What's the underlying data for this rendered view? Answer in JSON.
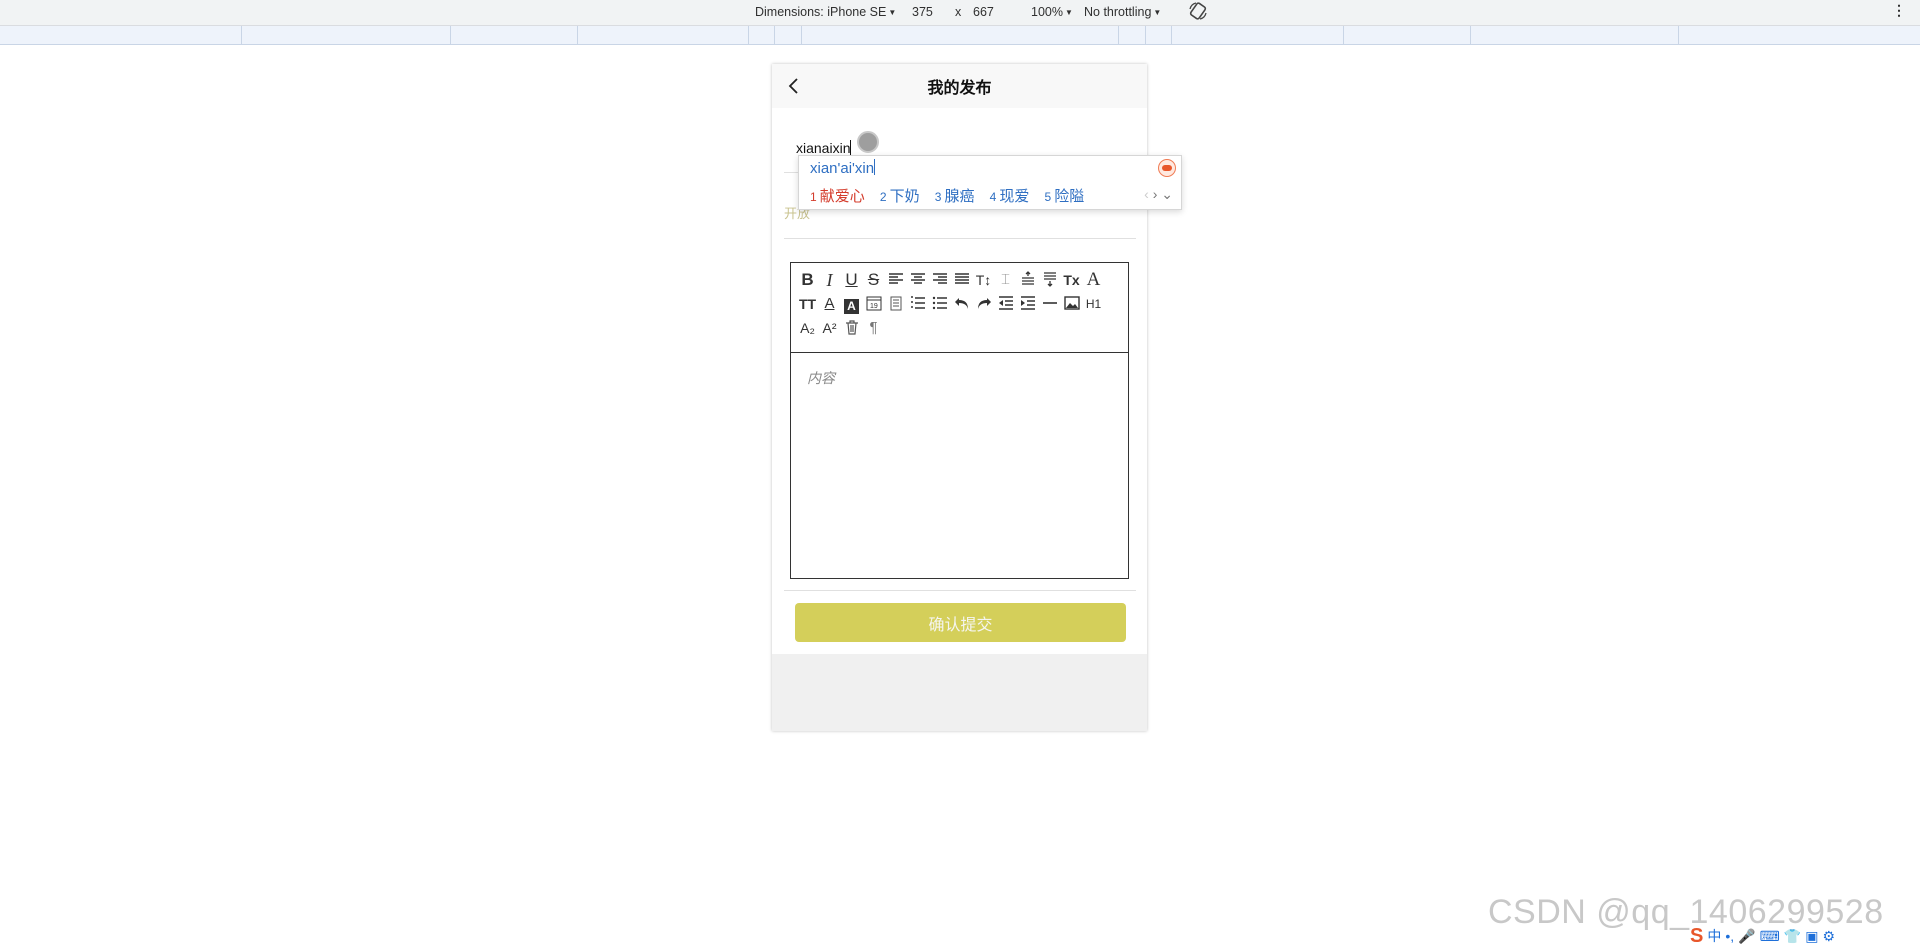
{
  "devtools": {
    "dimensions_label": "Dimensions: iPhone SE",
    "width": "375",
    "times": "x",
    "height": "667",
    "zoom": "100%",
    "throttling": "No throttling",
    "menu": "⋮"
  },
  "page": {
    "nav_title": "我的发布",
    "title_value": "xianaixin",
    "category_label": "开放",
    "content_placeholder": "内容",
    "submit_label": "确认提交"
  },
  "toolbar": {
    "buttons": [
      "B",
      "I",
      "U",
      "S",
      "≡",
      "≡",
      "≡",
      "≡",
      "T↕",
      "⌶",
      "≡",
      "≡",
      "Tx",
      "A",
      "TT",
      "A",
      "A",
      "19",
      "📋",
      "☰",
      "☰",
      "↶",
      "↷",
      "⇤",
      "⇥",
      "—",
      "▣",
      "H1",
      "A₂",
      "A²",
      "🗑",
      "¶"
    ]
  },
  "ime": {
    "pinyin": "xian'ai'xin",
    "candidates": [
      {
        "n": "1",
        "text": "献爱心"
      },
      {
        "n": "2",
        "text": "下奶"
      },
      {
        "n": "3",
        "text": "腺癌"
      },
      {
        "n": "4",
        "text": "现爱"
      },
      {
        "n": "5",
        "text": "险隘"
      }
    ]
  },
  "watermark": "CSDN @qq_1406299528",
  "tray": {
    "ime_mode": "中",
    "punct": "•,"
  },
  "colors": {
    "submit_bg": "#d4cf5a",
    "ime_first": "#d43c2c",
    "ime_text": "#2f6fc2"
  }
}
